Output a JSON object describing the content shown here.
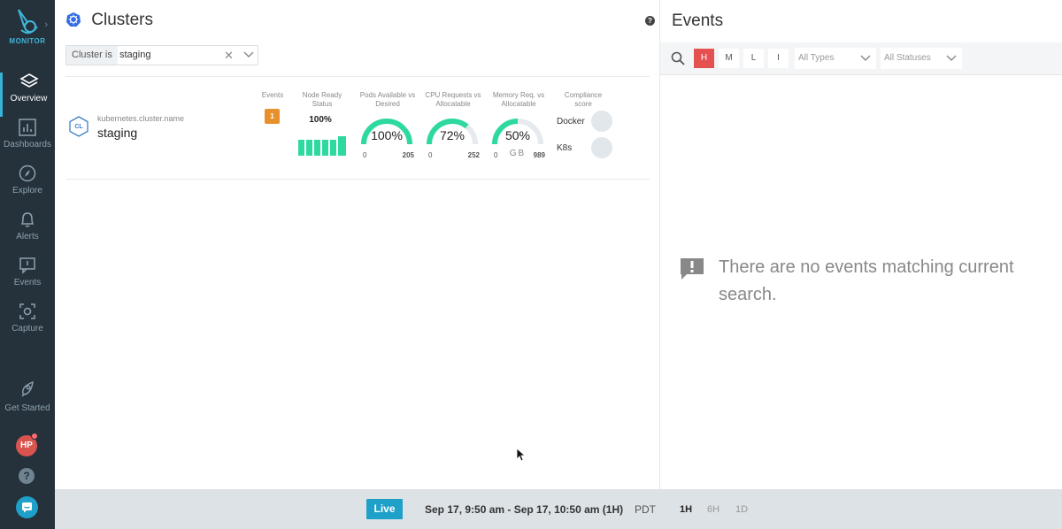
{
  "sidebar": {
    "brand": "MONITOR",
    "items": [
      {
        "label": "Overview",
        "icon": "layers-icon"
      },
      {
        "label": "Dashboards",
        "icon": "dashboard-icon"
      },
      {
        "label": "Explore",
        "icon": "compass-icon"
      },
      {
        "label": "Alerts",
        "icon": "bell-icon"
      },
      {
        "label": "Events",
        "icon": "events-icon"
      },
      {
        "label": "Capture",
        "icon": "capture-icon"
      }
    ],
    "get_started": "Get Started",
    "avatar_initials": "HP",
    "help_glyph": "?"
  },
  "clusters": {
    "title": "Clusters",
    "filter": {
      "key": "Cluster  is",
      "value": "staging"
    },
    "columns": {
      "events": "Events",
      "node_ready": "Node Ready Status",
      "pods": "Pods Available vs Desired",
      "cpu": "CPU Requests vs Allocatable",
      "memory": "Memory Req. vs Allocatable",
      "compliance": "Compliance score"
    },
    "row": {
      "badge": "CL",
      "label_key": "kubernetes.cluster.name",
      "name": "staging",
      "events_count": "1",
      "node_ready_pct": "100%",
      "node_ready_fraction": 1.0,
      "pods": {
        "value": "100%",
        "fraction": 1.0,
        "min": "0",
        "max": "205"
      },
      "cpu": {
        "value": "72%",
        "fraction": 0.72,
        "min": "0",
        "max": "252"
      },
      "memory": {
        "value": "50%",
        "fraction": 0.5,
        "min": "0",
        "max": "989",
        "unit": "GB"
      },
      "compliance": [
        {
          "label": "Docker"
        },
        {
          "label": "K8s"
        }
      ]
    }
  },
  "events": {
    "title": "Events",
    "severity_buttons": [
      "H",
      "M",
      "L",
      "I"
    ],
    "types_placeholder": "All Types",
    "statuses_placeholder": "All Statuses",
    "empty_message": "There are no events matching current search."
  },
  "footer": {
    "live_label": "Live",
    "time_range": "Sep 17, 9:50 am - Sep 17, 10:50 am (1H)",
    "timezone": "PDT",
    "windows": [
      "1H",
      "6H",
      "1D"
    ],
    "active_window": "1H"
  },
  "colors": {
    "sidebar_bg": "#25313b",
    "accent": "#1ea0c8",
    "gauge_fill": "#2ed9a0",
    "severity_high": "#e55050",
    "events_badge": "#e8912c"
  }
}
